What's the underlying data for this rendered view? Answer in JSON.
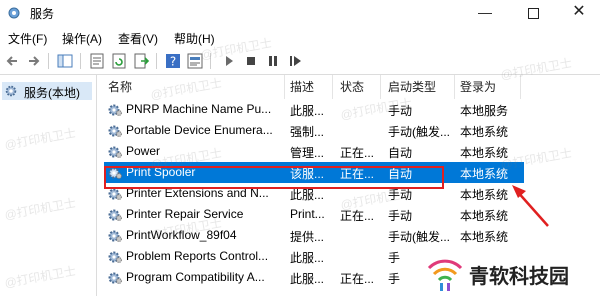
{
  "window": {
    "title": "服务",
    "minimize_glyph": "—",
    "close_glyph": "✕"
  },
  "menu": [
    "文件(F)",
    "操作(A)",
    "查看(V)",
    "帮助(H)"
  ],
  "tree": {
    "root_label": "服务(本地)"
  },
  "columns": [
    "名称",
    "描述",
    "状态",
    "启动类型",
    "登录为"
  ],
  "rows": [
    {
      "name": "PNRP Machine Name Pu...",
      "desc": "此服...",
      "status": "",
      "startup": "手动",
      "logon": "本地服务"
    },
    {
      "name": "Portable Device Enumera...",
      "desc": "强制...",
      "status": "",
      "startup": "手动(触发...",
      "logon": "本地系统"
    },
    {
      "name": "Power",
      "desc": "管理...",
      "status": "正在...",
      "startup": "自动",
      "logon": "本地系统"
    },
    {
      "name": "Print Spooler",
      "desc": "该服...",
      "status": "正在...",
      "startup": "自动",
      "logon": "本地系统",
      "selected": true
    },
    {
      "name": "Printer Extensions and N...",
      "desc": "此服...",
      "status": "",
      "startup": "手动",
      "logon": "本地系统"
    },
    {
      "name": "Printer Repair Service",
      "desc": "Print...",
      "status": "正在...",
      "startup": "手动",
      "logon": "本地系统"
    },
    {
      "name": "PrintWorkflow_89f04",
      "desc": "提供...",
      "status": "",
      "startup": "手动(触发...",
      "logon": "本地系统"
    },
    {
      "name": "Problem Reports Control...",
      "desc": "此服...",
      "status": "",
      "startup": "手",
      "logon": ""
    },
    {
      "name": "Program Compatibility A...",
      "desc": "此服...",
      "status": "正在...",
      "startup": "手",
      "logon": ""
    }
  ],
  "watermark": "@打印机卫士",
  "logo": {
    "text": "青软科技园"
  },
  "colors": {
    "selection": "#0078d7",
    "highlight_box": "#e02020",
    "arrow": "#e02020"
  },
  "icons": [
    "app-services-icon",
    "back-icon",
    "forward-icon",
    "console-tree-icon",
    "properties-icon",
    "refresh-icon",
    "export-icon",
    "help-icon",
    "view-icon",
    "play-icon",
    "stop-icon",
    "pause-icon",
    "restart-icon",
    "gear-icon"
  ]
}
